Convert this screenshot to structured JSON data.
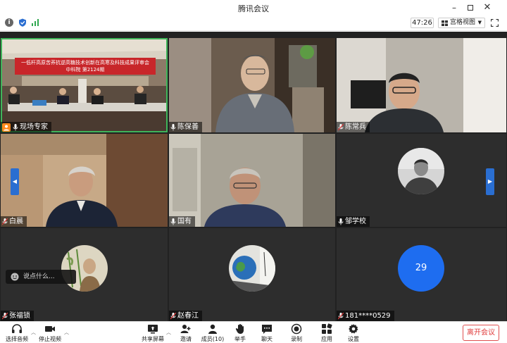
{
  "window": {
    "title": "腾讯会议"
  },
  "toolbar": {
    "timer": "47:26",
    "view_label": "宫格视图"
  },
  "participants": [
    {
      "name": "现场专家"
    },
    {
      "name": "陈保善"
    },
    {
      "name": "陈常兵"
    },
    {
      "name": "白晨"
    },
    {
      "name": "国有"
    },
    {
      "name": "邹学校"
    },
    {
      "name": "张福锁"
    },
    {
      "name": "赵春江"
    },
    {
      "name": "181****0529",
      "avatar_number": "29"
    }
  ],
  "banner": {
    "line1": "一低杆高原苦荞抗逆高糖技术创新在高寒及科技成果评审会",
    "line2": "中科院  第2124期"
  },
  "chat": {
    "placeholder": "说点什么..."
  },
  "bottom": {
    "audio": "选择音频",
    "video": "停止视频",
    "share": "共享屏幕",
    "invite": "邀请",
    "members": "成员(10)",
    "raise": "举手",
    "chat": "聊天",
    "record": "录制",
    "apps": "应用",
    "settings": "设置",
    "leave": "离开会议"
  },
  "colors": {
    "accent": "#2a6ed1",
    "leave": "#e03c3c",
    "avatar_blue": "#1e6df0",
    "active_border": "#3fb55a"
  }
}
